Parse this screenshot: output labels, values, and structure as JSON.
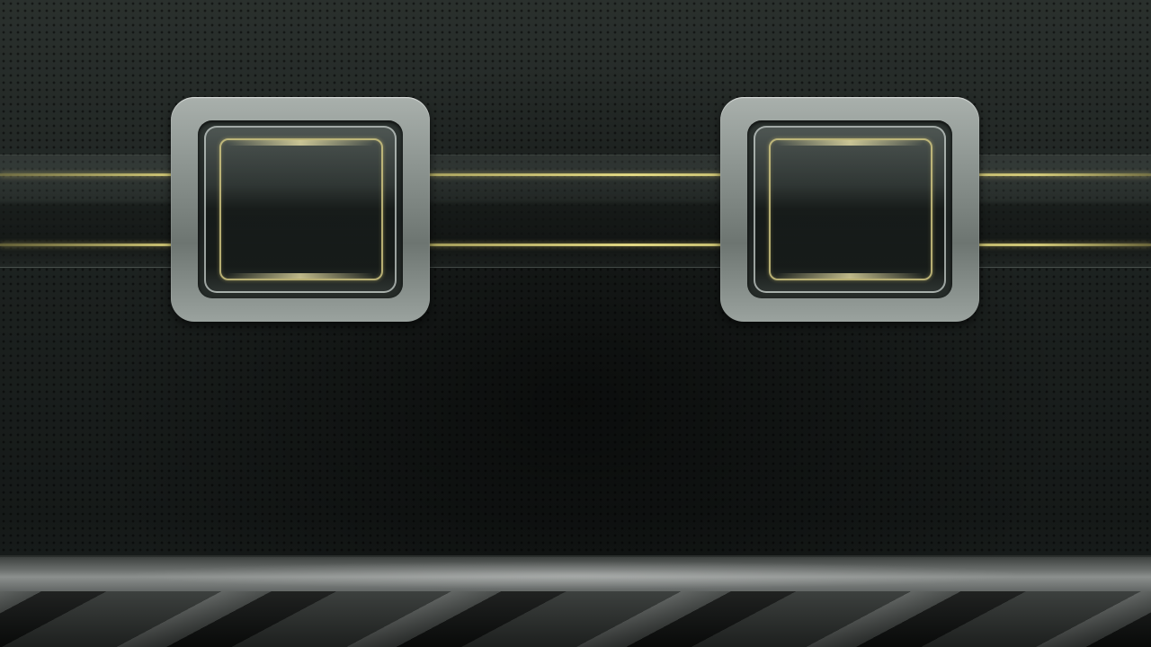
{
  "screen": {
    "theme": "dark-metal",
    "accent_color": "#d7cd78",
    "background_color": "#1d2220"
  },
  "tiles": [
    {
      "name": "slot-left",
      "icon": "empty-app-slot"
    },
    {
      "name": "slot-right",
      "icon": "empty-app-slot"
    }
  ]
}
